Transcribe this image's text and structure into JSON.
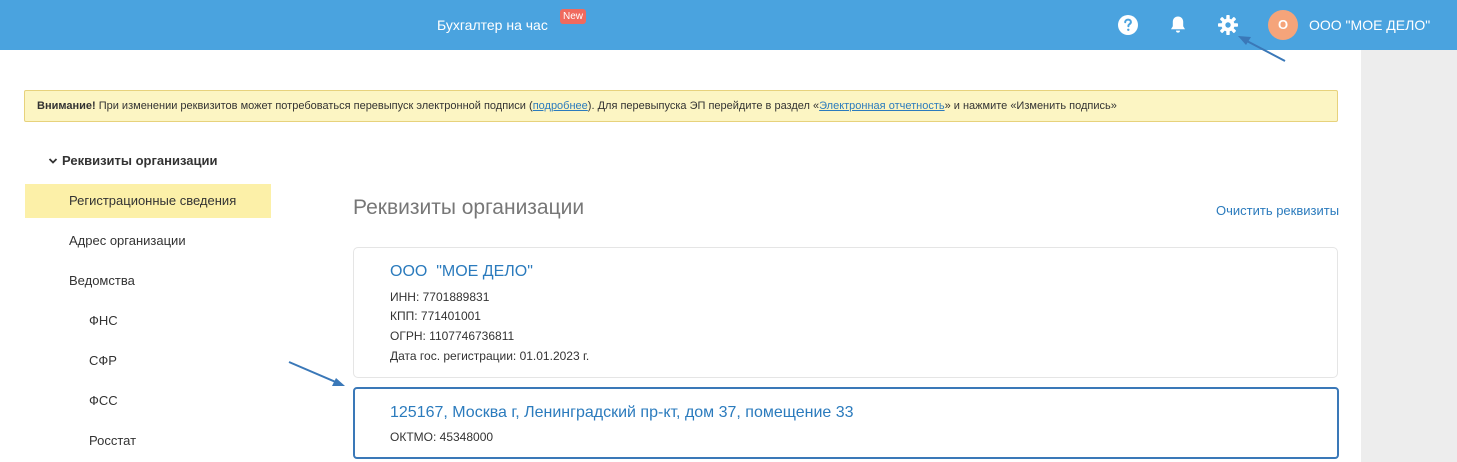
{
  "topbar": {
    "service_label": "Бухгалтер на час",
    "new_badge": "New",
    "help_icon": "help-circle-icon",
    "bell_icon": "bell-icon",
    "gear_icon": "gear-icon",
    "avatar_letter": "О",
    "org_name": "ООО \"МОЕ ДЕЛО\"",
    "bg_color": "#4aa3df"
  },
  "warning": {
    "bold": "Внимание!",
    "text1": " При изменении реквизитов может потребоваться перевыпуск электронной подписи (",
    "link1": "подробнее",
    "text2": "). Для перевыпуска ЭП перейдите в раздел «",
    "link2": "Электронная отчетность",
    "text3": "» и нажмите «Изменить подпись»"
  },
  "sidebar": {
    "section_title": "Реквизиты организации",
    "items": [
      {
        "label": "Регистрационные сведения",
        "active": true
      },
      {
        "label": "Адрес организации"
      },
      {
        "label": "Ведомства"
      },
      {
        "label": "ФНС"
      },
      {
        "label": "СФР"
      },
      {
        "label": "ФСС"
      },
      {
        "label": "Росстат"
      }
    ]
  },
  "main": {
    "title": "Реквизиты организации",
    "clear_link": "Очистить реквизиты",
    "org_card": {
      "name": "ООО  \"МОЕ ДЕЛО\"",
      "inn": "ИНН: 7701889831",
      "kpp": "КПП: 771401001",
      "ogrn": "ОГРН: 1107746736811",
      "reg_date": "Дата гос. регистрации: 01.01.2023 г."
    },
    "address_card": {
      "address": "125167, Москва г, Ленинградский пр-кт, дом 37, помещение 33",
      "oktmo": "ОКТМО: 45348000"
    }
  }
}
